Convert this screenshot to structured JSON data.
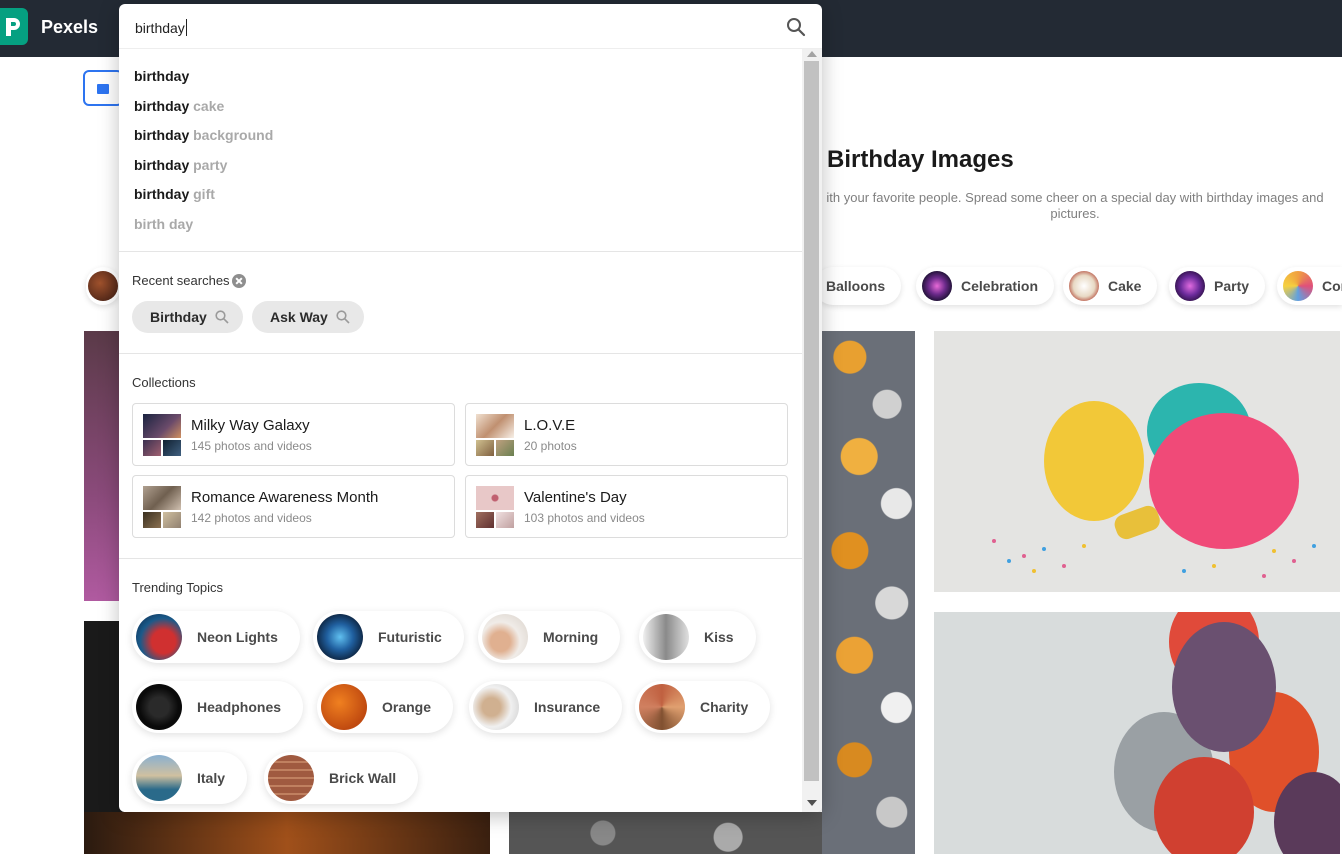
{
  "header": {
    "brand": "Pexels",
    "logo_icon": "pexels-logo-icon"
  },
  "search": {
    "value": "birthday",
    "icon": "search-icon"
  },
  "suggestions": [
    {
      "bold": "birthday",
      "rest": ""
    },
    {
      "bold": "birthday",
      "rest": " cake"
    },
    {
      "bold": "birthday",
      "rest": " background"
    },
    {
      "bold": "birthday",
      "rest": " party"
    },
    {
      "bold": "birthday",
      "rest": " gift"
    },
    {
      "bold": "",
      "rest": "birth day"
    }
  ],
  "recent": {
    "label": "Recent searches",
    "items": [
      "Birthday",
      "Ask Way"
    ]
  },
  "collections": {
    "label": "Collections",
    "items": [
      {
        "title": "Milky Way Galaxy",
        "subtitle": "145 photos and videos"
      },
      {
        "title": "L.O.V.E",
        "subtitle": "20 photos"
      },
      {
        "title": "Romance Awareness Month",
        "subtitle": "142 photos and videos"
      },
      {
        "title": "Valentine's Day",
        "subtitle": "103 photos and videos"
      }
    ]
  },
  "trending": {
    "label": "Trending Topics",
    "items": [
      "Neon Lights",
      "Futuristic",
      "Morning",
      "Kiss",
      "Headphones",
      "Orange",
      "Insurance",
      "Charity",
      "Italy",
      "Brick Wall"
    ]
  },
  "page": {
    "title": "Birthday Images",
    "description": "ith your favorite people. Spread some cheer on a special day with birthday images and pictures.",
    "chips": [
      "Balloons",
      "Celebration",
      "Cake",
      "Party",
      "Cor"
    ]
  },
  "colors": {
    "accent": "#05a081",
    "header_bg": "#232a34",
    "tab_blue": "#2d74f0"
  }
}
